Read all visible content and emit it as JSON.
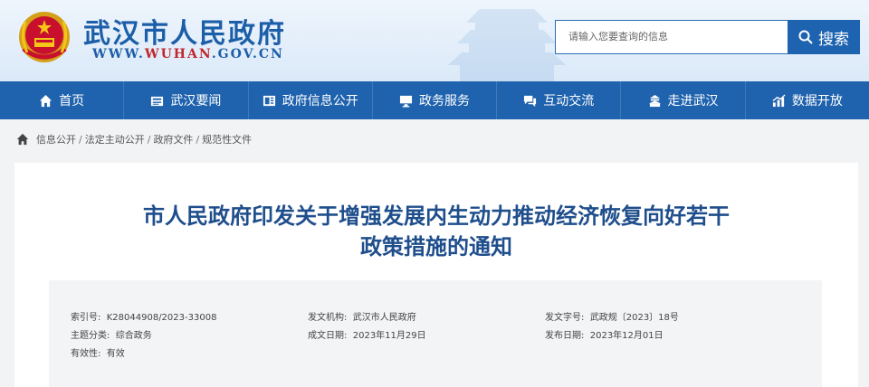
{
  "header": {
    "site_name": "武汉市人民政府",
    "url_prefix": "WWW.",
    "url_highlight": "WUHAN",
    "url_suffix": ".GOV.CN",
    "search_placeholder": "请输入您要查询的信息",
    "search_button": "搜索"
  },
  "nav": {
    "items": [
      {
        "label": "首页",
        "icon": "home-icon"
      },
      {
        "label": "武汉要闻",
        "icon": "newspaper-icon"
      },
      {
        "label": "政府信息公开",
        "icon": "info-icon"
      },
      {
        "label": "政务服务",
        "icon": "monitor-icon"
      },
      {
        "label": "互动交流",
        "icon": "chat-icon"
      },
      {
        "label": "走进武汉",
        "icon": "building-icon"
      },
      {
        "label": "数据开放",
        "icon": "chart-icon"
      }
    ]
  },
  "breadcrumb": [
    "信息公开",
    "法定主动公开",
    "政府文件",
    "规范性文件"
  ],
  "document": {
    "title_line1": "市人民政府印发关于增强发展内生动力推动经济恢复向好若干",
    "title_line2": "政策措施的通知",
    "meta": {
      "index_label": "索引号:",
      "index_value": "K28044908/2023-33008",
      "issuer_label": "发文机构:",
      "issuer_value": "武汉市人民政府",
      "docno_label": "发文字号:",
      "docno_value": "武政规〔2023〕18号",
      "topic_label": "主题分类:",
      "topic_value": "综合政务",
      "created_label": "成文日期:",
      "created_value": "2023年11月29日",
      "published_label": "发布日期:",
      "published_value": "2023年12月01日",
      "validity_label": "有效性:",
      "validity_value": "有效"
    }
  },
  "colors": {
    "primary": "#1f62ad",
    "title": "#1f4e8c",
    "accent_red": "#c0272d"
  }
}
